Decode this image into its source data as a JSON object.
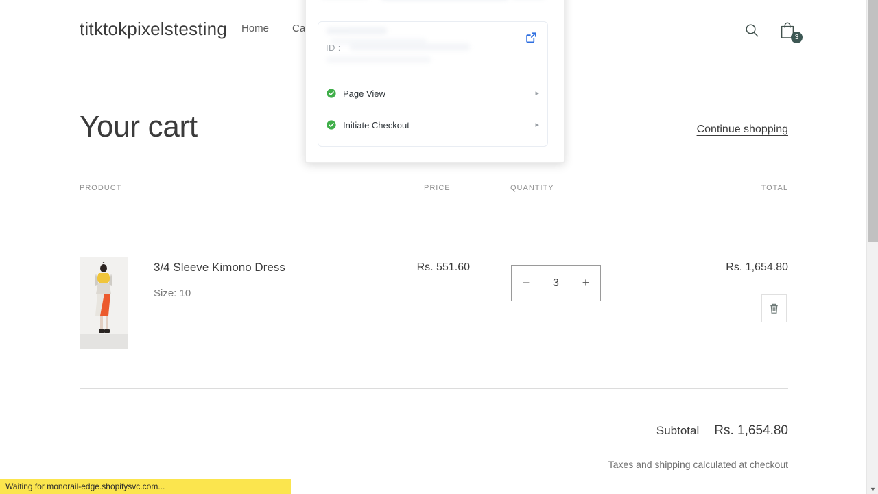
{
  "header": {
    "store_name": "titktokpixelstesting",
    "nav": [
      {
        "label": "Home"
      },
      {
        "label": "Catal"
      }
    ],
    "search_icon": "search-icon",
    "cart_icon": "shopping-bag-icon",
    "cart_count": "3",
    "badge_color": "#3d5854"
  },
  "cart": {
    "title": "Your cart",
    "continue_shopping": "Continue shopping",
    "columns": {
      "product": "PRODUCT",
      "price": "PRICE",
      "quantity": "QUANTITY",
      "total": "TOTAL"
    },
    "items": [
      {
        "title": "3/4 Sleeve Kimono Dress",
        "variant": "Size: 10",
        "price": "Rs. 551.60",
        "quantity": "3",
        "decrease_label": "−",
        "increase_label": "+",
        "total": "Rs. 1,654.80",
        "remove_icon": "trash-icon"
      }
    ],
    "subtotal_label": "Subtotal",
    "subtotal_value": "Rs. 1,654.80",
    "tax_note": "Taxes and shipping calculated at checkout"
  },
  "debugger_popup": {
    "id_label": "ID :",
    "id_value": "",
    "external_link_icon": "external-link-icon",
    "external_link_color": "#2f6fe0",
    "check_color": "#3fae49",
    "events": [
      {
        "label": "Page View",
        "status_icon": "check-circle-icon",
        "chevron": "▸"
      },
      {
        "label": "Initiate Checkout",
        "status_icon": "check-circle-icon",
        "chevron": "▸"
      }
    ]
  },
  "scrollbar": {
    "down_arrow": "▼"
  },
  "statusbar": {
    "text": "Waiting for monorail-edge.shopifysvc.com..."
  }
}
